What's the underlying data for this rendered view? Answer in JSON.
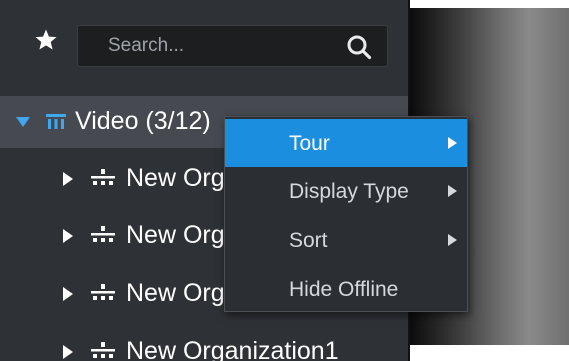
{
  "search": {
    "placeholder": "Search..."
  },
  "tree": {
    "root": {
      "label": "Video (3/12)"
    },
    "children": [
      {
        "label": "New Organization1"
      },
      {
        "label": "New Organization1"
      },
      {
        "label": "New Organization1"
      },
      {
        "label": "New Organization1"
      }
    ]
  },
  "context_menu": {
    "items": [
      {
        "label": "Tour",
        "has_submenu": true,
        "highlighted": true
      },
      {
        "label": "Display Type",
        "has_submenu": true,
        "highlighted": false
      },
      {
        "label": "Sort",
        "has_submenu": true,
        "highlighted": false
      },
      {
        "label": "Hide Offline",
        "has_submenu": false,
        "highlighted": false
      }
    ]
  },
  "icons": {
    "favorites": "star-icon",
    "search": "search-icon",
    "expanded": "caret-down-icon",
    "collapsed": "caret-right-icon",
    "video_group": "video-group-icon",
    "organization": "organization-icon",
    "submenu": "submenu-arrow-icon"
  },
  "colors": {
    "panel_bg": "#2e3135",
    "selected_row_bg": "#464a50",
    "menu_bg": "#2b2e32",
    "menu_highlight": "#1b8ee0",
    "accent_blue": "#3ea7f0"
  }
}
